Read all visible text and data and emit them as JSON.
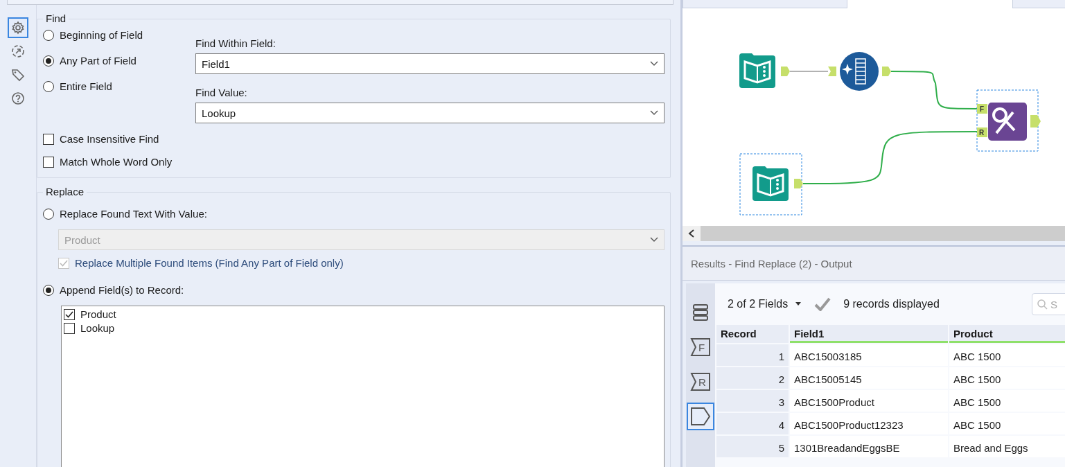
{
  "sidebar": {
    "items": [
      {
        "kind": "gear",
        "selected": true
      },
      {
        "kind": "connect",
        "selected": false
      },
      {
        "kind": "tag",
        "selected": false
      },
      {
        "kind": "help",
        "selected": false
      }
    ]
  },
  "find": {
    "title": "Find",
    "modes": [
      {
        "label": "Beginning of Field",
        "selected": false
      },
      {
        "label": "Any Part of Field",
        "selected": true
      },
      {
        "label": "Entire Field",
        "selected": false
      }
    ],
    "within_label": "Find Within Field:",
    "within_value": "Field1",
    "value_label": "Find Value:",
    "value": "Lookup",
    "options": [
      {
        "label": "Case Insensitive Find",
        "checked": false
      },
      {
        "label": "Match Whole Word Only",
        "checked": false
      }
    ]
  },
  "replace": {
    "title": "Replace",
    "replace_mode": {
      "label": "Replace Found Text With Value:",
      "selected": false
    },
    "replace_value": "Product",
    "disabled": true,
    "multiple": {
      "label": "Replace Multiple Found Items (Find Any Part of Field only)",
      "checked": true
    },
    "append_mode": {
      "label": "Append Field(s) to Record:",
      "selected": true
    },
    "append_fields": [
      {
        "label": "Product",
        "checked": true
      },
      {
        "label": "Lookup",
        "checked": false
      }
    ]
  },
  "workflow": {
    "find_replace_inputs": [
      "F",
      "R"
    ]
  },
  "results": {
    "title": "Results - Find Replace (2) - Output",
    "fields_selector": "2 of 2 Fields",
    "records_count": "9 records displayed",
    "search_placeholder": "S",
    "side_items": [
      {
        "kind": "list",
        "selected": false
      },
      {
        "kind": "input",
        "label": "F",
        "selected": false
      },
      {
        "kind": "input",
        "label": "R",
        "selected": false
      },
      {
        "kind": "output",
        "selected": true
      }
    ],
    "table": {
      "columns": [
        "Record",
        "Field1",
        "Product"
      ],
      "rows": [
        [
          "1",
          "ABC15003185",
          "ABC 1500"
        ],
        [
          "2",
          "ABC15005145",
          "ABC 1500"
        ],
        [
          "3",
          "ABC1500Product",
          "ABC 1500"
        ],
        [
          "4",
          "ABC1500Product12323",
          "ABC 1500"
        ],
        [
          "5",
          "1301BreadandEggsBE",
          "Bread and Eggs"
        ]
      ]
    }
  }
}
